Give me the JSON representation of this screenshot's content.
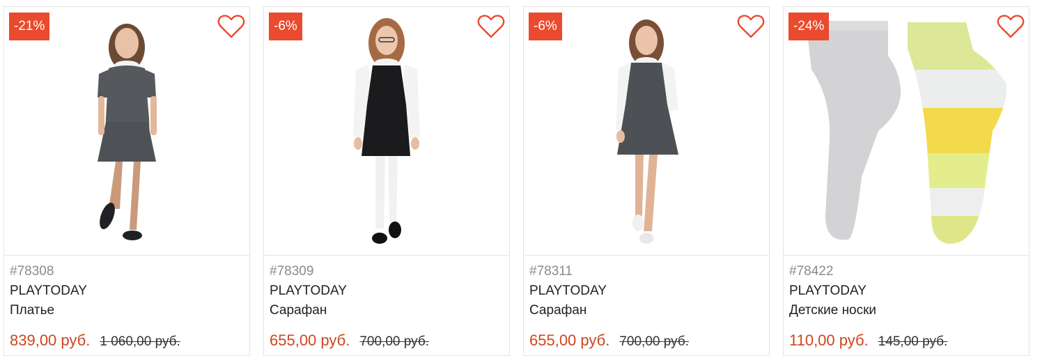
{
  "colors": {
    "badge": "#ea4a2d",
    "price": "#cf4520",
    "heart": "#ea4a2d"
  },
  "products": [
    {
      "discount": "-21%",
      "sku": "#78308",
      "brand": "PLAYTODAY",
      "title": "Платье",
      "price": "839,00 руб.",
      "old_price": "1 060,00 руб.",
      "icon": "heart-outline-icon"
    },
    {
      "discount": "-6%",
      "sku": "#78309",
      "brand": "PLAYTODAY",
      "title": "Сарафан",
      "price": "655,00 руб.",
      "old_price": "700,00 руб.",
      "icon": "heart-outline-icon"
    },
    {
      "discount": "-6%",
      "sku": "#78311",
      "brand": "PLAYTODAY",
      "title": "Сарафан",
      "price": "655,00 руб.",
      "old_price": "700,00 руб.",
      "icon": "heart-outline-icon"
    },
    {
      "discount": "-24%",
      "sku": "#78422",
      "brand": "PLAYTODAY",
      "title": "Детские носки",
      "price": "110,00 руб.",
      "old_price": "145,00 руб.",
      "icon": "heart-outline-icon"
    }
  ]
}
